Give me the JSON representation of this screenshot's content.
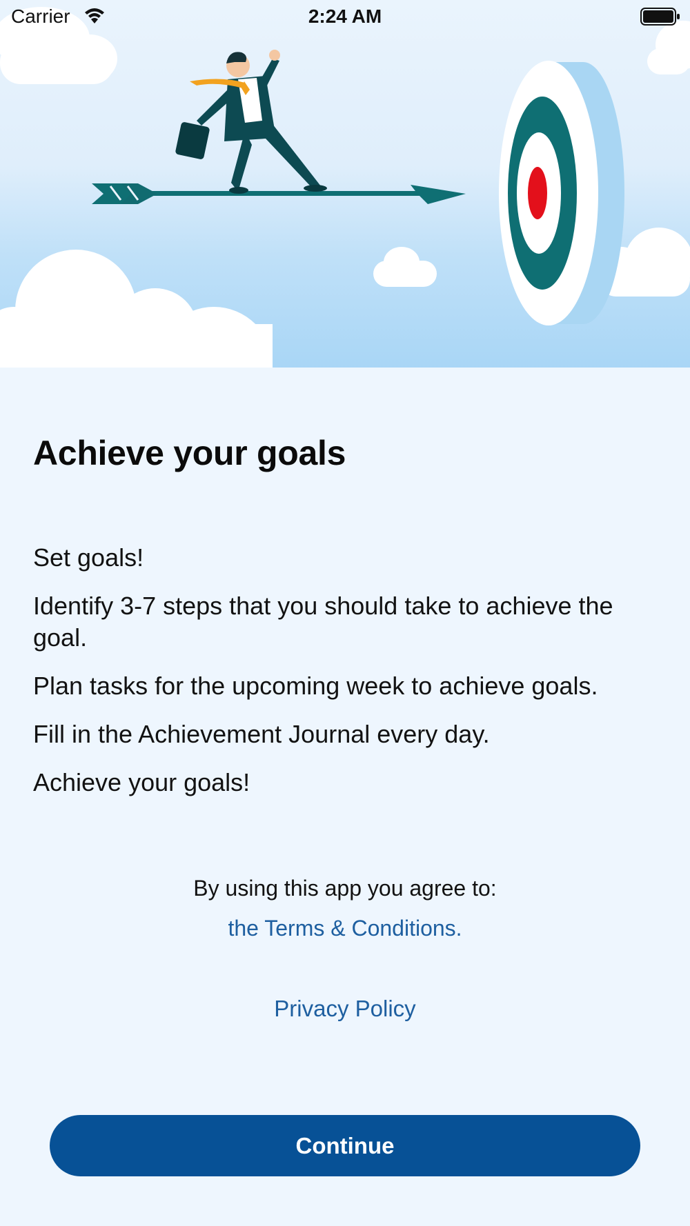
{
  "status_bar": {
    "carrier": "Carrier",
    "time": "2:24 AM",
    "wifi_icon": "wifi-icon",
    "battery_icon": "battery-icon"
  },
  "hero": {
    "illustration": "businessman-riding-arrow-toward-target",
    "colors": {
      "sky": "#bfe0f8",
      "arrow": "#0f6f73",
      "target_ring": "#0f6f73",
      "target_center": "#e3101b",
      "tie": "#f2a21f",
      "suit": "#0d4a52"
    }
  },
  "content": {
    "headline": "Achieve your goals",
    "points": [
      "Set goals!",
      "Identify 3-7 steps that you should take to achieve the goal.",
      "Plan tasks for the upcoming week to achieve goals.",
      "Fill in the Achievement Journal every day.",
      "Achieve your goals!"
    ]
  },
  "legal": {
    "agree_text": "By using this app you agree to:",
    "terms_link": "the Terms & Conditions.",
    "privacy_link": "Privacy Policy"
  },
  "actions": {
    "continue_label": "Continue",
    "accent": "#075196",
    "link_color": "#1e5fa0"
  }
}
